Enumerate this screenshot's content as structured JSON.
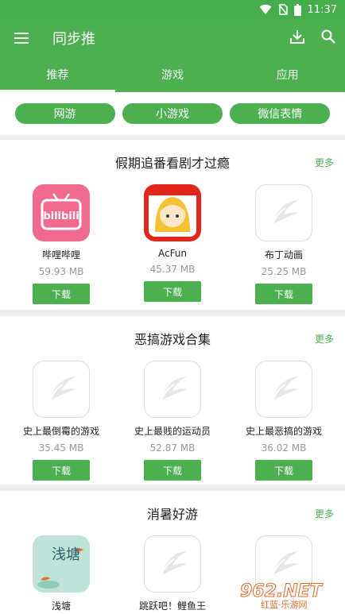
{
  "status_bar": {
    "time": "11:37"
  },
  "app_bar": {
    "title": "同步推"
  },
  "tabs": [
    {
      "label": "推荐",
      "active": true
    },
    {
      "label": "游戏",
      "active": false
    },
    {
      "label": "应用",
      "active": false
    }
  ],
  "chips": [
    "网游",
    "小游戏",
    "微信表情"
  ],
  "sections": [
    {
      "title": "假期追番看剧才过瘾",
      "more": "更多",
      "apps": [
        {
          "name": "哔哩哔哩",
          "size": "59.93 MB",
          "download": "下载",
          "icon": "bilibili-icon"
        },
        {
          "name": "AcFun",
          "size": "45.37 MB",
          "download": "下载",
          "icon": "acfun-icon"
        },
        {
          "name": "布丁动画",
          "size": "25.25 MB",
          "download": "下载",
          "icon": "placeholder-icon"
        }
      ]
    },
    {
      "title": "恶搞游戏合集",
      "more": "更多",
      "apps": [
        {
          "name": "史上最倒霉的游戏",
          "size": "35.45 MB",
          "download": "下载",
          "icon": "placeholder-icon"
        },
        {
          "name": "史上最贱的运动员",
          "size": "52.87 MB",
          "download": "下载",
          "icon": "placeholder-icon"
        },
        {
          "name": "史上最恶搞的游戏",
          "size": "36.02 MB",
          "download": "下载",
          "icon": "placeholder-icon"
        }
      ]
    },
    {
      "title": "消暑好游",
      "more": "更多",
      "apps": [
        {
          "name": "浅塘",
          "icon": "qiantang-icon",
          "icon_text": "浅塘"
        },
        {
          "name": "跳跃吧！鲤鱼王",
          "icon": "placeholder-icon"
        },
        {
          "name": "",
          "icon": "placeholder-icon"
        }
      ]
    }
  ],
  "watermark": {
    "text": "962.NET",
    "subtext": "红蓝·乐游网"
  },
  "colors": {
    "primary": "#4caf50",
    "status": "#45ad4c",
    "bilibili": "#f06a8e",
    "acfun": "#e1261c"
  }
}
